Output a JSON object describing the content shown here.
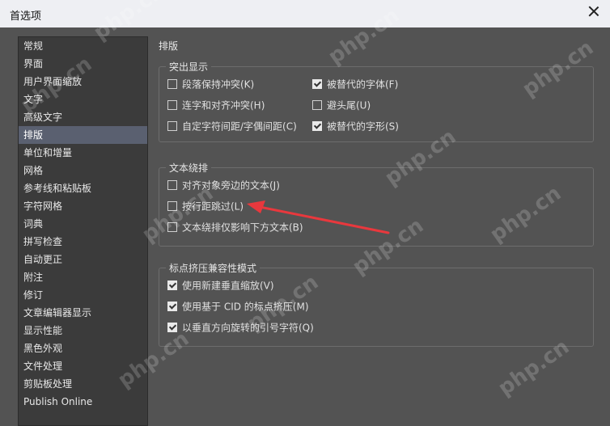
{
  "window": {
    "title": "首选项"
  },
  "sidebar": {
    "items": [
      {
        "label": "常规"
      },
      {
        "label": "界面"
      },
      {
        "label": "用户界面缩放"
      },
      {
        "label": "文字"
      },
      {
        "label": "高级文字"
      },
      {
        "label": "排版"
      },
      {
        "label": "单位和增量"
      },
      {
        "label": "网格"
      },
      {
        "label": "参考线和粘贴板"
      },
      {
        "label": "字符网格"
      },
      {
        "label": "词典"
      },
      {
        "label": "拼写检查"
      },
      {
        "label": "自动更正"
      },
      {
        "label": "附注"
      },
      {
        "label": "修订"
      },
      {
        "label": "文章编辑器显示"
      },
      {
        "label": "显示性能"
      },
      {
        "label": "黑色外观"
      },
      {
        "label": "文件处理"
      },
      {
        "label": "剪贴板处理"
      },
      {
        "label": "Publish Online"
      }
    ],
    "active_index": 5
  },
  "main": {
    "section_title": "排版",
    "highlight": {
      "label": "突出显示",
      "options": [
        {
          "label": "段落保持冲突(K)",
          "checked": false
        },
        {
          "label": "连字和对齐冲突(H)",
          "checked": false
        },
        {
          "label": "自定字符间距/字偶间距(C)",
          "checked": false
        },
        {
          "label": "被替代的字体(F)",
          "checked": true
        },
        {
          "label": "避头尾(U)",
          "checked": false
        },
        {
          "label": "被替代的字形(S)",
          "checked": true
        }
      ]
    },
    "text_wrap": {
      "label": "文本绕排",
      "options": [
        {
          "label": "对齐对象旁边的文本(J)",
          "checked": false
        },
        {
          "label": "按行距跳过(L)",
          "checked": false
        },
        {
          "label": "文本绕排仅影响下方文本(B)",
          "checked": false
        }
      ]
    },
    "punctuation": {
      "label": "标点挤压兼容性模式",
      "options": [
        {
          "label": "使用新建垂直缩放(V)",
          "checked": true
        },
        {
          "label": "使用基于 CID 的标点挤压(M)",
          "checked": true
        },
        {
          "label": "以垂直方向旋转的引号字符(Q)",
          "checked": true
        }
      ]
    }
  },
  "colors": {
    "annotation_arrow": "#e8383d",
    "active_item": "#5a6070"
  },
  "watermark": "php.cn"
}
